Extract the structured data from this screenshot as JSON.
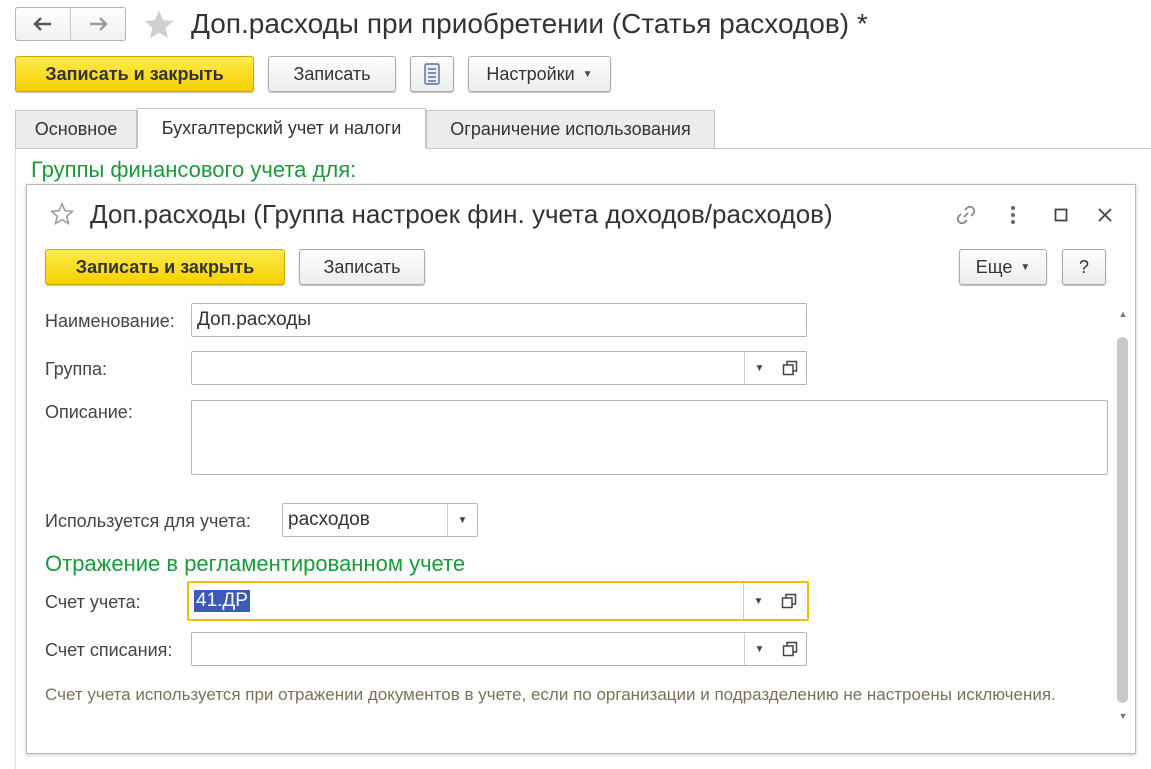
{
  "window": {
    "title": "Доп.расходы при приобретении (Статья расходов) *"
  },
  "toolbar": {
    "save_close": "Записать и закрыть",
    "save": "Записать",
    "settings": "Настройки"
  },
  "tabs": [
    {
      "label": "Основное"
    },
    {
      "label": "Бухгалтерский учет и налоги"
    },
    {
      "label": "Ограничение использования"
    }
  ],
  "section_title": "Группы финансового учета для:",
  "dialog": {
    "title": "Доп.расходы (Группа настроек фин. учета доходов/расходов)",
    "save_close": "Записать и закрыть",
    "save": "Записать",
    "more": "Еще",
    "help": "?",
    "name_label": "Наименование:",
    "name_value": "Доп.расходы",
    "group_label": "Группа:",
    "group_value": "",
    "desc_label": "Описание:",
    "desc_value": "",
    "used_for_label": "Используется для учета:",
    "used_for_value": "расходов",
    "reg_section": "Отражение в регламентированном учете",
    "account_label": "Счет учета:",
    "account_value": "41.ДР",
    "writeoff_label": "Счет списания:",
    "writeoff_value": "",
    "note": "Счет учета используется при отражении документов в учете, если по организации и подразделению не настроены исключения."
  },
  "colors": {
    "primary_button": "#f5d000",
    "section_green": "#1b9a3a",
    "focus_border": "#f0c000",
    "selection": "#3d5ab8"
  }
}
